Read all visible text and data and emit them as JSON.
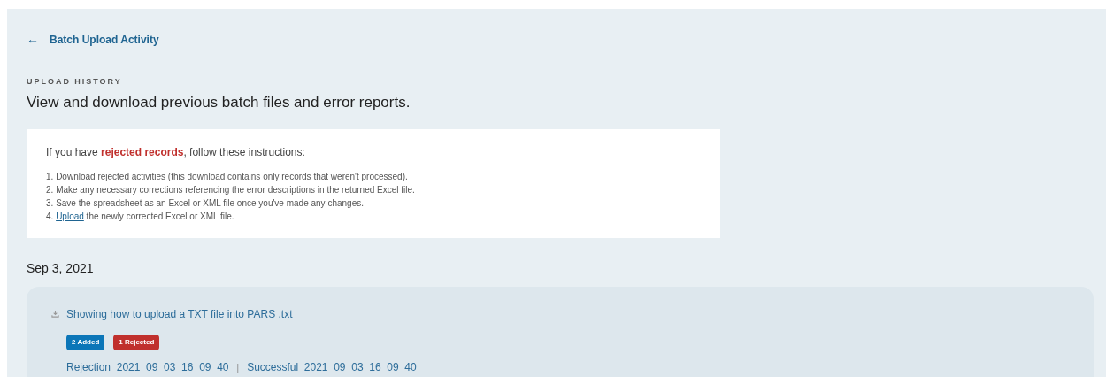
{
  "back_link": {
    "arrow": "←",
    "label": "Batch Upload Activity"
  },
  "header": {
    "eyebrow": "UPLOAD HISTORY",
    "title": "View and download previous batch files and error reports."
  },
  "instructions": {
    "intro": "If you have **rejected records**, follow these instructions:",
    "steps": [
      {
        "prefix": "1.",
        "text": "Download rejected activities (this download contains only records that weren't processed)."
      },
      {
        "prefix": "2.",
        "text": "Make any necessary corrections referencing the error descriptions in the returned Excel file."
      },
      {
        "prefix": "3.",
        "text": "Save the spreadsheet as an Excel or XML file once you've made any changes."
      },
      {
        "prefix": "4.",
        "link": "Upload",
        "text": "the newly corrected Excel or XML file."
      }
    ]
  },
  "groups": [
    {
      "date": "Sep 3, 2021",
      "uploads": [
        {
          "file_name": "Showing how to upload a TXT file into PARS .txt",
          "badges": [
            {
              "label": "2 Added",
              "color": "#0b76b8"
            },
            {
              "label": "1 Rejected",
              "color": "#c0302d"
            }
          ],
          "reports": [
            "Rejection_2021_09_03_16_09_40",
            "Successful_2021_09_03_16_09_40"
          ],
          "separator": "|"
        }
      ]
    }
  ]
}
